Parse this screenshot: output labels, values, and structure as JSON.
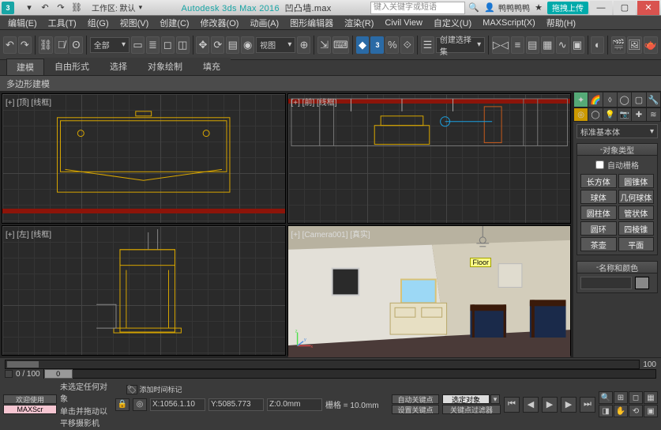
{
  "title": {
    "app": "Autodesk 3ds Max 2016",
    "file": "凹凸墙.max",
    "workspace_label": "工作区: 默认",
    "search_placeholder": "键入关键字或短语",
    "signin": "鸭鸭鸭鸭",
    "share": "拖拽上传"
  },
  "menu": [
    "编辑(E)",
    "工具(T)",
    "组(G)",
    "视图(V)",
    "创建(C)",
    "修改器(O)",
    "动画(A)",
    "图形编辑器",
    "渲染(R)",
    "Civil View",
    "自定义(U)",
    "MAXScript(X)",
    "帮助(H)"
  ],
  "toolbar": {
    "selection_set": "全部",
    "creation_dropdown": "创建选择集",
    "view_dropdown": "视图"
  },
  "ribbon": {
    "tabs": [
      "建模",
      "自由形式",
      "选择",
      "对象绘制",
      "填充"
    ],
    "sub": "多边形建模"
  },
  "viewports": {
    "top": "[+] [顶] [线框]",
    "front": "[+] [前] [线框]",
    "left": "[+] [左] [线框]",
    "camera": "[+] [Camera001] [真实]",
    "floor_label": "Floor"
  },
  "command_panel": {
    "dropdown": "标准基本体",
    "rollout_type": "对象类型",
    "autogrid": "自动栅格",
    "objects": [
      "长方体",
      "圆锥体",
      "球体",
      "几何球体",
      "圆柱体",
      "管状体",
      "圆环",
      "四棱锥",
      "茶壶",
      "平面"
    ],
    "rollout_name": "名称和颜色"
  },
  "timeline": {
    "frame": "0 / 100",
    "range_end": "100"
  },
  "status": {
    "welcome": "欢迎使用",
    "maxscript": "MAXScr",
    "none_selected": "未选定任何对象",
    "prompt": "单击并拖动以平移摄影机",
    "x": "X:1056.1.10",
    "y": "Y:5085.773",
    "z": "Z:0.0mm",
    "grid": "栅格 = 10.0mm",
    "autokey": "自动关键点",
    "selected": "选定对象",
    "setkey": "设置关键点",
    "filters": "关键点过滤器",
    "addtimetag": "添加时间标记"
  }
}
